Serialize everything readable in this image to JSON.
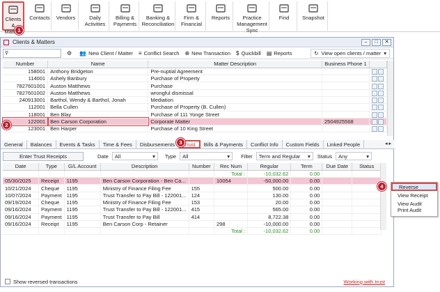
{
  "ribbon": {
    "items": [
      {
        "label": "Clients &\nMatters",
        "icon": "clients-matters-icon"
      },
      {
        "label": "Contacts",
        "icon": "contacts-icon"
      },
      {
        "label": "Vendors",
        "icon": "vendors-icon"
      },
      {
        "label": "Daily\nActivities",
        "icon": "daily-activities-icon"
      },
      {
        "label": "Billing &\nPayments",
        "icon": "billing-icon"
      },
      {
        "label": "Banking &\nReconciliation",
        "icon": "bank-icon"
      },
      {
        "label": "Firm &\nFinancial",
        "icon": "firm-icon"
      },
      {
        "label": "Reports",
        "icon": "reports-icon"
      },
      {
        "label": "Practice\nManagement\nSync",
        "icon": "sync-icon"
      },
      {
        "label": "Find",
        "icon": "search-icon"
      },
      {
        "label": "Snapshot",
        "icon": "camera-icon"
      }
    ]
  },
  "callouts": [
    "1",
    "2",
    "3",
    "4"
  ],
  "window": {
    "title": "Clients & Matters",
    "buttons": [
      "–",
      "□",
      "✕"
    ],
    "toolbar": {
      "new_client": "New Client / Matter",
      "conflict": "Conflict Search",
      "new_tx": "New Transaction",
      "quickbill": "Quickbill",
      "reports": "Reports",
      "view": "View open clients / matter"
    },
    "matters": {
      "headers": [
        "Number",
        "Name",
        "Matter Description",
        "Business Phone 1"
      ],
      "rows": [
        [
          "158001",
          "Anthony Bridgeton",
          "Pre-nuptial Agreement",
          ""
        ],
        [
          "114001",
          "Ashely Banbury",
          "Purchase of Property",
          ""
        ],
        [
          "7827601001",
          "Auston Matthews",
          "Purchase",
          ""
        ],
        [
          "7827601002",
          "Auston Matthews",
          "wrongful dismissal",
          ""
        ],
        [
          "240913001",
          "Barthol, Wendy & Barthol, Jonah",
          "Mediation",
          ""
        ],
        [
          "112001",
          "Bella Cullen",
          "Purchase of Property (B. Cullen)",
          ""
        ],
        [
          "118001",
          "Ben Blay",
          "Purchase of 111 Yonge Street",
          ""
        ],
        [
          "122001",
          "Ben Carson Corporation",
          "Corporate Matter",
          "2504925568"
        ],
        [
          "123001",
          "Ben Harper",
          "Purchase of 10 King Street",
          ""
        ]
      ]
    },
    "tabs": [
      "General",
      "Balances",
      "Events & Tasks",
      "Time & Fees",
      "Disbursements",
      "Trust",
      "Bills & Payments",
      "Conflict Info",
      "Custom Fields",
      "Linked People"
    ],
    "filters": {
      "enter_btn": "Enter Trust Receipts",
      "date_label": "Date",
      "date_val": "All",
      "type_label": "Type",
      "type_val": "All",
      "filter_label": "Filter",
      "filter_val": "Term and Regular",
      "status_label": "Status",
      "status_val": "Any"
    },
    "trust": {
      "headers": [
        "Date",
        "Type",
        "G/L Account",
        "Description",
        "Number",
        "Rec Num",
        "Regular",
        "Term",
        "Due Date",
        "Status"
      ],
      "total_label": "Total :",
      "total_regular": "-10,032.62",
      "total_term": "0.00",
      "rows": [
        [
          "05/30/2025",
          "Receipt",
          "1195",
          "Ben Carson Corporation - Ben Ca...",
          "",
          "10054",
          "-50,000.00",
          "0.00",
          "",
          ""
        ],
        [
          "10/21/2024",
          "Cheque",
          "1195",
          "Ministry of Finance Filing Fee",
          "155",
          "",
          "500.00",
          "0.00",
          "",
          ""
        ],
        [
          "10/07/2024",
          "Payment",
          "1195",
          "Trust Transfer to Pay Bill - 122001...",
          "124",
          "",
          "130.00",
          "0.00",
          "",
          ""
        ],
        [
          "09/19/2024",
          "Cheque",
          "1195",
          "Ministry of Finance Filing Fee",
          "153",
          "",
          "20.00",
          "0.00",
          "",
          ""
        ],
        [
          "09/16/2024",
          "Payment",
          "1195",
          "Trust Transfer to Pay Bill - 122001...",
          "415",
          "",
          "565.00",
          "0.00",
          "",
          ""
        ],
        [
          "09/16/2024",
          "Payment",
          "1195",
          "Trust Transfer to Pay Bill",
          "414",
          "",
          "8,722.38",
          "0.00",
          "",
          ""
        ],
        [
          "09/16/2024",
          "Receipt",
          "1195",
          "Ben Carson Corp - Retainer",
          "",
          "298",
          "-10,000.00",
          "0.00",
          "",
          ""
        ]
      ],
      "bottom_total_label": "Total :",
      "bottom_total_regular": "-10,032.62",
      "bottom_total_term": "0.00"
    },
    "context_menu": [
      "Reverse",
      "View Receipt",
      "View Audit",
      "Print Audit"
    ],
    "footer": {
      "checkbox_label": "Show reversed transactions",
      "link": "Working with trust"
    }
  }
}
